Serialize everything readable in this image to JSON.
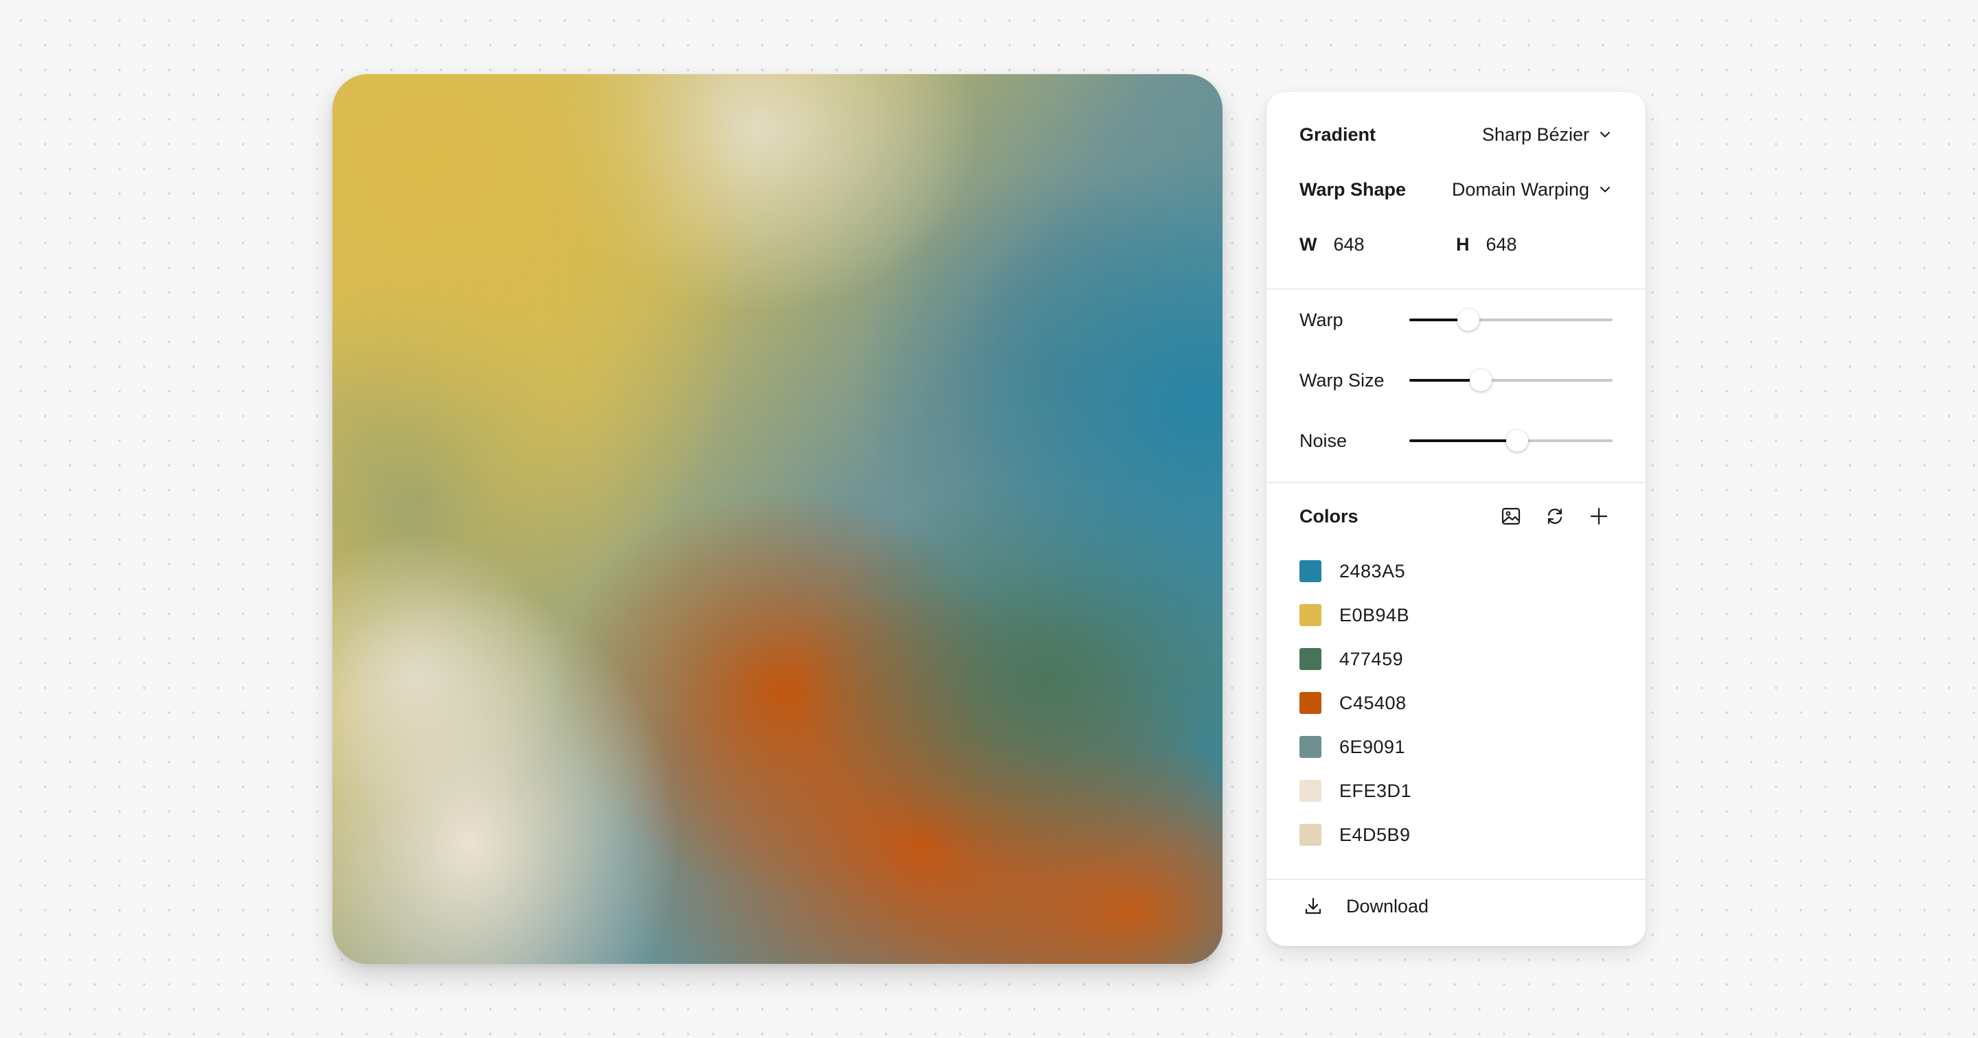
{
  "canvas": {
    "colors": [
      "#2483A5",
      "#E0B94B",
      "#477459",
      "#C45408",
      "#6E9091",
      "#EFE3D1",
      "#E4D5B9"
    ]
  },
  "settings": {
    "gradient": {
      "label": "Gradient",
      "value": "Sharp Bézier"
    },
    "warp_shape": {
      "label": "Warp Shape",
      "value": "Domain Warping"
    },
    "width": {
      "label": "W",
      "value": "648"
    },
    "height": {
      "label": "H",
      "value": "648"
    }
  },
  "sliders": [
    {
      "label": "Warp",
      "value": 0.29
    },
    {
      "label": "Warp Size",
      "value": 0.35
    },
    {
      "label": "Noise",
      "value": 0.53
    }
  ],
  "colors_section": {
    "title": "Colors",
    "icons": [
      "image-icon",
      "refresh-icon",
      "plus-icon"
    ],
    "items": [
      {
        "hex": "2483A5",
        "color": "#2483A5"
      },
      {
        "hex": "E0B94B",
        "color": "#E0B94B"
      },
      {
        "hex": "477459",
        "color": "#477459"
      },
      {
        "hex": "C45408",
        "color": "#C45408"
      },
      {
        "hex": "6E9091",
        "color": "#6E9091"
      },
      {
        "hex": "EFE3D1",
        "color": "#EFE3D1"
      },
      {
        "hex": "E4D5B9",
        "color": "#E4D5B9"
      }
    ]
  },
  "download": {
    "label": "Download",
    "icon": "download-icon"
  }
}
